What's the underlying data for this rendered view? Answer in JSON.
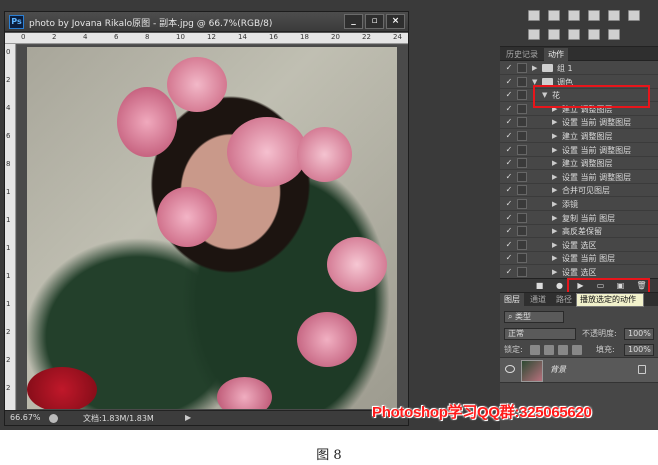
{
  "document": {
    "title": "photo by Jovana Rikalo原图 - 副本.jpg @ 66.7%(RGB/8)",
    "zoom": "66.67%",
    "doc_size": "文档:1.83M/1.83M",
    "window_buttons": {
      "minimize": "_",
      "maximize": "▫",
      "close": "×"
    },
    "ruler_h": [
      "0",
      "2",
      "4",
      "6",
      "8",
      "10",
      "12",
      "14",
      "16",
      "18",
      "20",
      "22",
      "24"
    ],
    "ruler_v": [
      "0",
      "2",
      "4",
      "6",
      "8",
      "1",
      "1",
      "1",
      "1",
      "1",
      "2",
      "2",
      "2"
    ]
  },
  "panel": {
    "tabs": [
      "历史记录",
      "动作"
    ],
    "actions": [
      {
        "check": "✓",
        "check_red": false,
        "toggle": "▶",
        "folder": true,
        "label": "组 1",
        "indent": 0
      },
      {
        "check": "✓",
        "check_red": false,
        "toggle": "▼",
        "folder": true,
        "label": "调色",
        "indent": 0
      },
      {
        "check": "✓",
        "check_red": false,
        "toggle": "▼",
        "folder": false,
        "label": "花",
        "indent": 1
      },
      {
        "check": "✓",
        "check_red": false,
        "toggle": "▶",
        "folder": false,
        "label": "建立 调整图层",
        "indent": 2
      },
      {
        "check": "✓",
        "check_red": false,
        "toggle": "▶",
        "folder": false,
        "label": "设置 当前 调整图层",
        "indent": 2
      },
      {
        "check": "✓",
        "check_red": false,
        "toggle": "▶",
        "folder": false,
        "label": "建立 调整图层",
        "indent": 2
      },
      {
        "check": "✓",
        "check_red": false,
        "toggle": "▶",
        "folder": false,
        "label": "设置 当前 调整图层",
        "indent": 2
      },
      {
        "check": "✓",
        "check_red": false,
        "toggle": "▶",
        "folder": false,
        "label": "建立 调整图层",
        "indent": 2
      },
      {
        "check": "✓",
        "check_red": false,
        "toggle": "▶",
        "folder": false,
        "label": "设置 当前 调整图层",
        "indent": 2
      },
      {
        "check": "✓",
        "check_red": false,
        "toggle": "▶",
        "folder": false,
        "label": "合并可见图层",
        "indent": 2
      },
      {
        "check": "✓",
        "check_red": false,
        "toggle": "▶",
        "folder": false,
        "label": "添镜",
        "indent": 2
      },
      {
        "check": "✓",
        "check_red": false,
        "toggle": "▶",
        "folder": false,
        "label": "复制 当前 图层",
        "indent": 2
      },
      {
        "check": "✓",
        "check_red": false,
        "toggle": "▶",
        "folder": false,
        "label": "高反差保留",
        "indent": 2
      },
      {
        "check": "✓",
        "check_red": false,
        "toggle": "▶",
        "folder": false,
        "label": "设置 选区",
        "indent": 2
      },
      {
        "check": "✓",
        "check_red": false,
        "toggle": "▶",
        "folder": false,
        "label": "设置 当前 图层",
        "indent": 2
      },
      {
        "check": "✓",
        "check_red": false,
        "toggle": "▶",
        "folder": false,
        "label": "设置 选区",
        "indent": 2
      }
    ],
    "bottom_icons": {
      "stop": "■",
      "record": "●",
      "play": "▶",
      "new_set": "▭",
      "new_action": "▣",
      "delete": "🗑"
    },
    "tooltip": "播放选定的动作"
  },
  "layers": {
    "tabs": [
      "图层",
      "通道",
      "路径"
    ],
    "filter_kind": "类型",
    "blend_mode": "正常",
    "opacity_label": "不透明度:",
    "opacity_value": "100%",
    "lock_label": "锁定:",
    "fill_label": "填充:",
    "fill_value": "100%",
    "layer_name": "背景"
  },
  "watermark": "Photoshop学习QQ群:325065620",
  "caption": "图 8",
  "colors": {
    "highlight": "#e8151b",
    "watermark": "#ff1a1a"
  }
}
